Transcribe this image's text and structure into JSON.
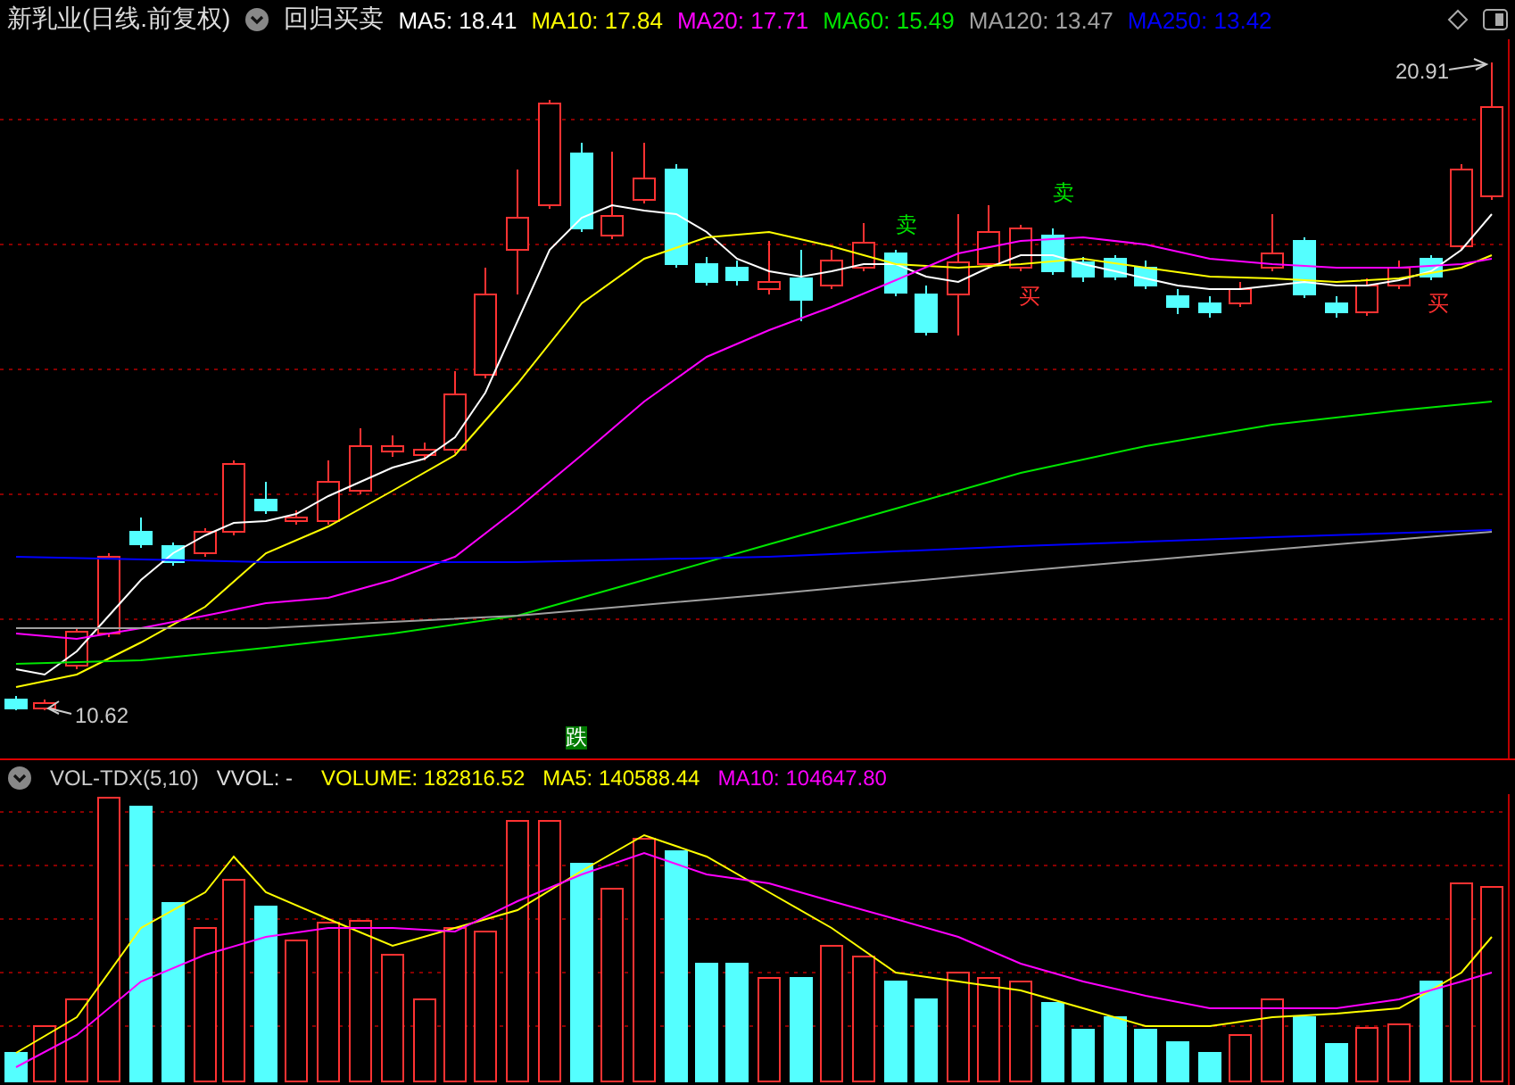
{
  "header": {
    "title": "新乳业(日线.前复权)",
    "formula": "回归买卖",
    "ma": [
      {
        "label": "MA5: 18.41",
        "color": "#ffffff"
      },
      {
        "label": "MA10: 17.84",
        "color": "#ffff00"
      },
      {
        "label": "MA20: 17.71",
        "color": "#ff00ff"
      },
      {
        "label": "MA60: 15.49",
        "color": "#00e600"
      },
      {
        "label": "MA120: 13.47",
        "color": "#a0a0a0"
      },
      {
        "label": "MA250: 13.42",
        "color": "#0000ff"
      }
    ]
  },
  "price_labels": [
    {
      "text": "20.91",
      "kind": "high"
    },
    {
      "text": "10.62",
      "kind": "low"
    }
  ],
  "signals": [
    {
      "text": "卖",
      "kind": "sell"
    },
    {
      "text": "卖",
      "kind": "sell"
    },
    {
      "text": "买",
      "kind": "buy"
    },
    {
      "text": "买",
      "kind": "buy"
    }
  ],
  "drop_marker": {
    "text": "跌"
  },
  "volume_header": {
    "title": "VOL-TDX(5,10)",
    "vvol": "VVOL: -",
    "values": [
      {
        "label": "VOLUME: 182816.52",
        "color": "#ffff00"
      },
      {
        "label": "MA5: 140588.44",
        "color": "#ffff00"
      },
      {
        "label": "MA10: 104647.80",
        "color": "#ff00ff"
      }
    ]
  }
}
